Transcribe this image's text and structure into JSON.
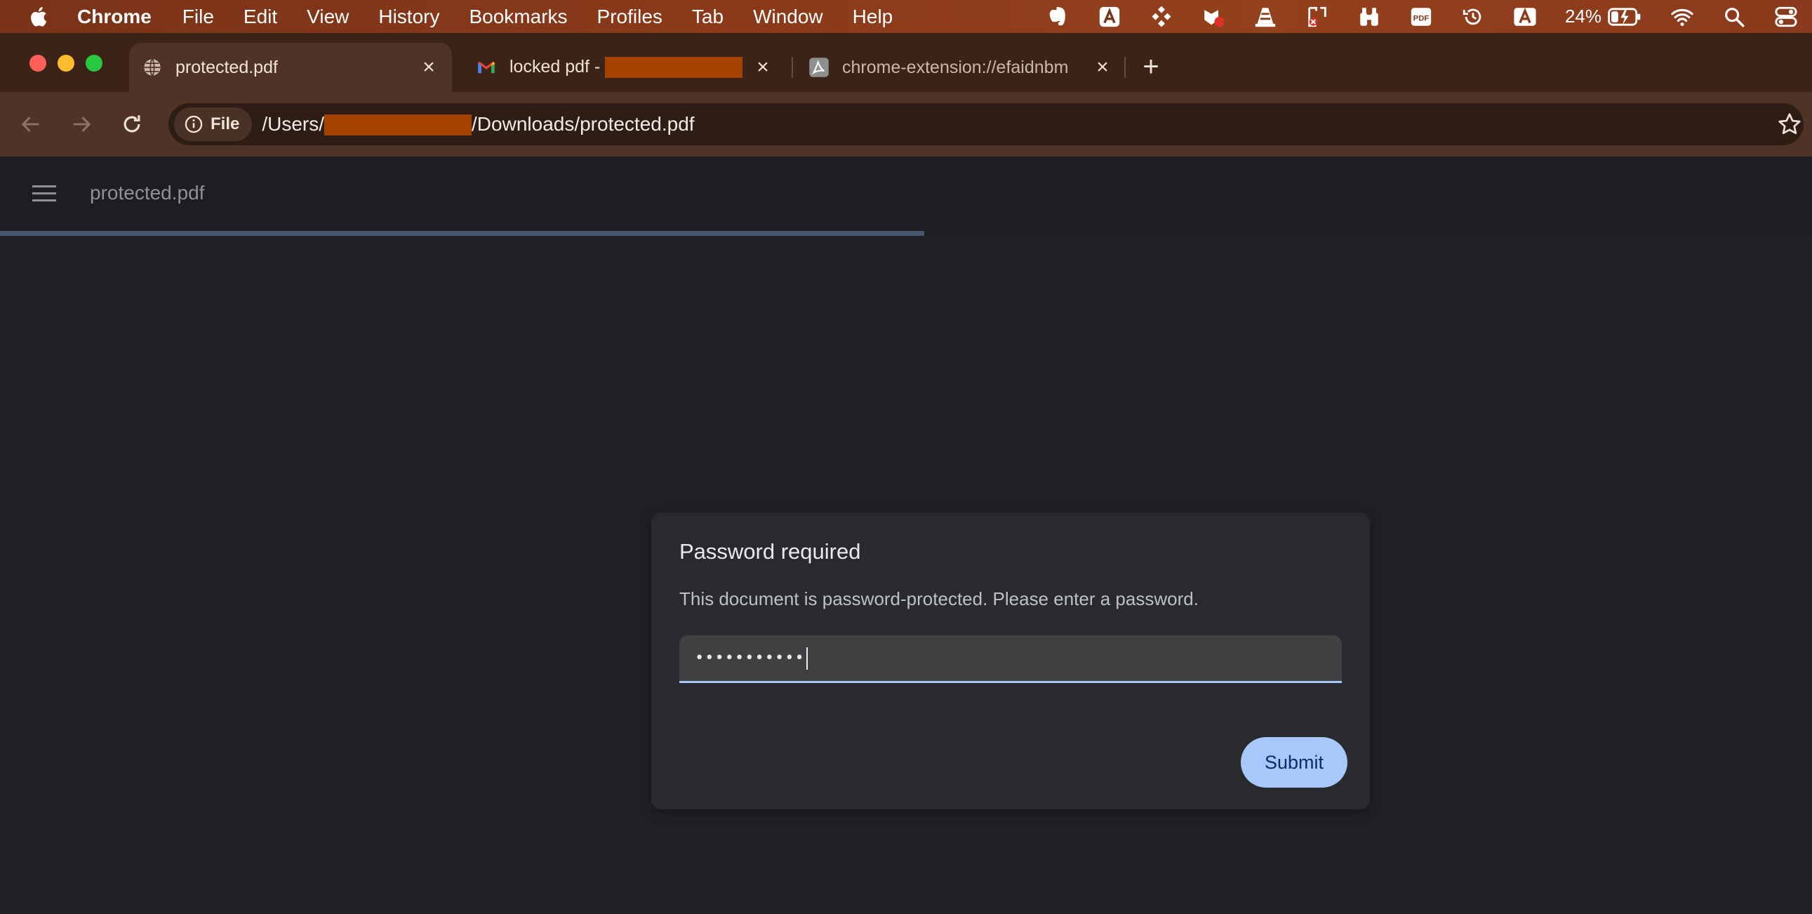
{
  "menubar": {
    "app_name": "Chrome",
    "items": [
      "File",
      "Edit",
      "View",
      "History",
      "Bookmarks",
      "Profiles",
      "Tab",
      "Window",
      "Help"
    ],
    "battery": "24%",
    "tray_icons": [
      "evernote-icon",
      "font-app-icon",
      "puzzle-icon",
      "recorder-icon",
      "vlc-icon",
      "ocr-icon",
      "binoculars-icon",
      "pdf-icon",
      "time-machine-icon",
      "keyboard-input-icon",
      "battery-icon",
      "wifi-icon",
      "spotlight-icon",
      "control-center-icon"
    ]
  },
  "tabs": [
    {
      "title": "protected.pdf",
      "icon": "globe-icon",
      "active": true
    },
    {
      "title": "locked pdf - ",
      "icon": "gmail-icon",
      "active": false
    },
    {
      "title": "chrome-extension://efaidnbm",
      "icon": "acrobat-icon",
      "active": false
    }
  ],
  "omnibox": {
    "chip_label": "File",
    "url_prefix": "/Users/",
    "url_suffix": "/Downloads/protected.pdf"
  },
  "pdf_viewer": {
    "title": "protected.pdf",
    "load_progress": 0.51
  },
  "dialog": {
    "title": "Password required",
    "description": "This document is password-protected. Please enter a password.",
    "password_masked": "•••••••••••",
    "submit_label": "Submit"
  },
  "colors": {
    "accent": "#a8c7fa",
    "dialog_bg": "#292a2d",
    "page_bg": "#202124",
    "tab_active": "#4f3326"
  }
}
